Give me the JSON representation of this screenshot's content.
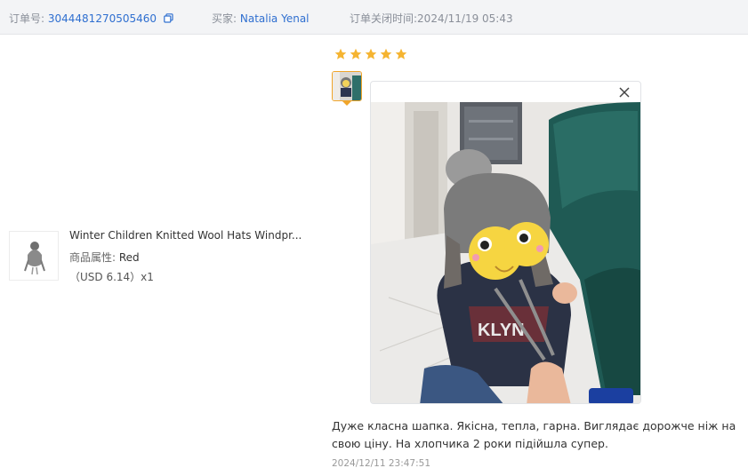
{
  "header": {
    "order_label": "订单号:",
    "order_number": "3044481270505460",
    "buyer_label": "买家:",
    "buyer_name": "Natalia Yenal",
    "close_time": "订单关闭时间:2024/11/19 05:43"
  },
  "product": {
    "title": "Winter Children Knitted Wool Hats Windpr...",
    "attr_label": "商品属性:",
    "attr_value": "Red",
    "price": "（USD  6.14）x1"
  },
  "review": {
    "rating": 5,
    "text": "Дуже класна шапка. Якісна, тепла, гарна. Виглядає дорожче ніж на свою ціну. На хлопчика 2 роки підійшла супер.",
    "time": "2024/12/11 23:47:51"
  },
  "colors": {
    "link": "#2f6fd0",
    "star": "#f5b431",
    "thumb_border": "#f0a52a"
  },
  "icons": {
    "copy": "copy-icon",
    "close": "close-icon",
    "star": "star-icon"
  }
}
